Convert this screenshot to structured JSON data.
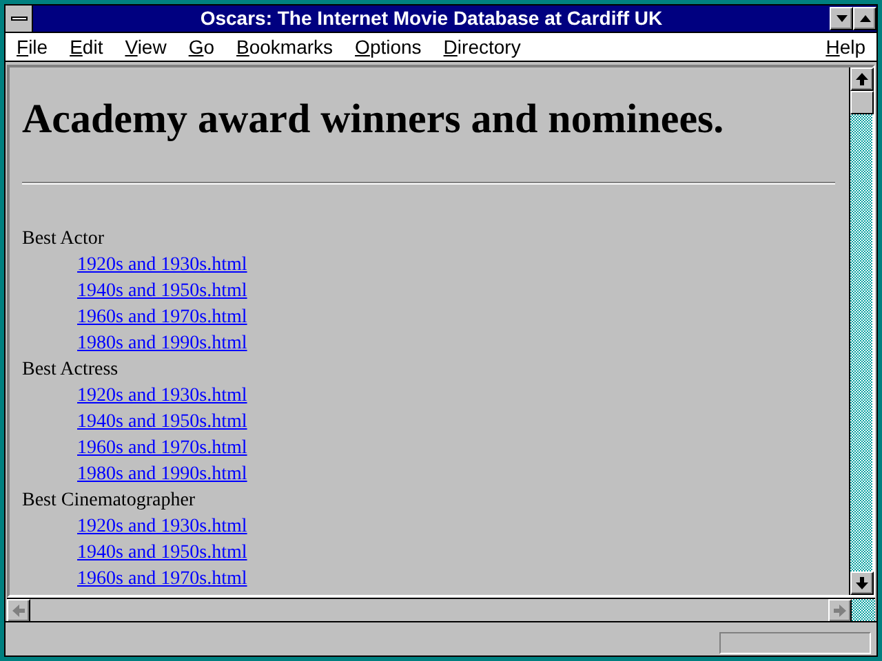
{
  "window": {
    "title": "Oscars: The Internet Movie Database at Cardiff UK"
  },
  "menu": [
    {
      "label": "File"
    },
    {
      "label": "Edit"
    },
    {
      "label": "View"
    },
    {
      "label": "Go"
    },
    {
      "label": "Bookmarks"
    },
    {
      "label": "Options"
    },
    {
      "label": "Directory"
    }
  ],
  "help_menu": {
    "label": "Help"
  },
  "page": {
    "heading": "Academy award winners and nominees.",
    "categories": [
      {
        "name": "Best Actor",
        "links": [
          "1920s and 1930s.html",
          "1940s and 1950s.html",
          "1960s and 1970s.html",
          "1980s and 1990s.html"
        ]
      },
      {
        "name": "Best Actress",
        "links": [
          "1920s and 1930s.html",
          "1940s and 1950s.html",
          "1960s and 1970s.html",
          "1980s and 1990s.html"
        ]
      },
      {
        "name": "Best Cinematographer",
        "links": [
          "1920s and 1930s.html",
          "1940s and 1950s.html",
          "1960s and 1970s.html"
        ]
      }
    ]
  }
}
